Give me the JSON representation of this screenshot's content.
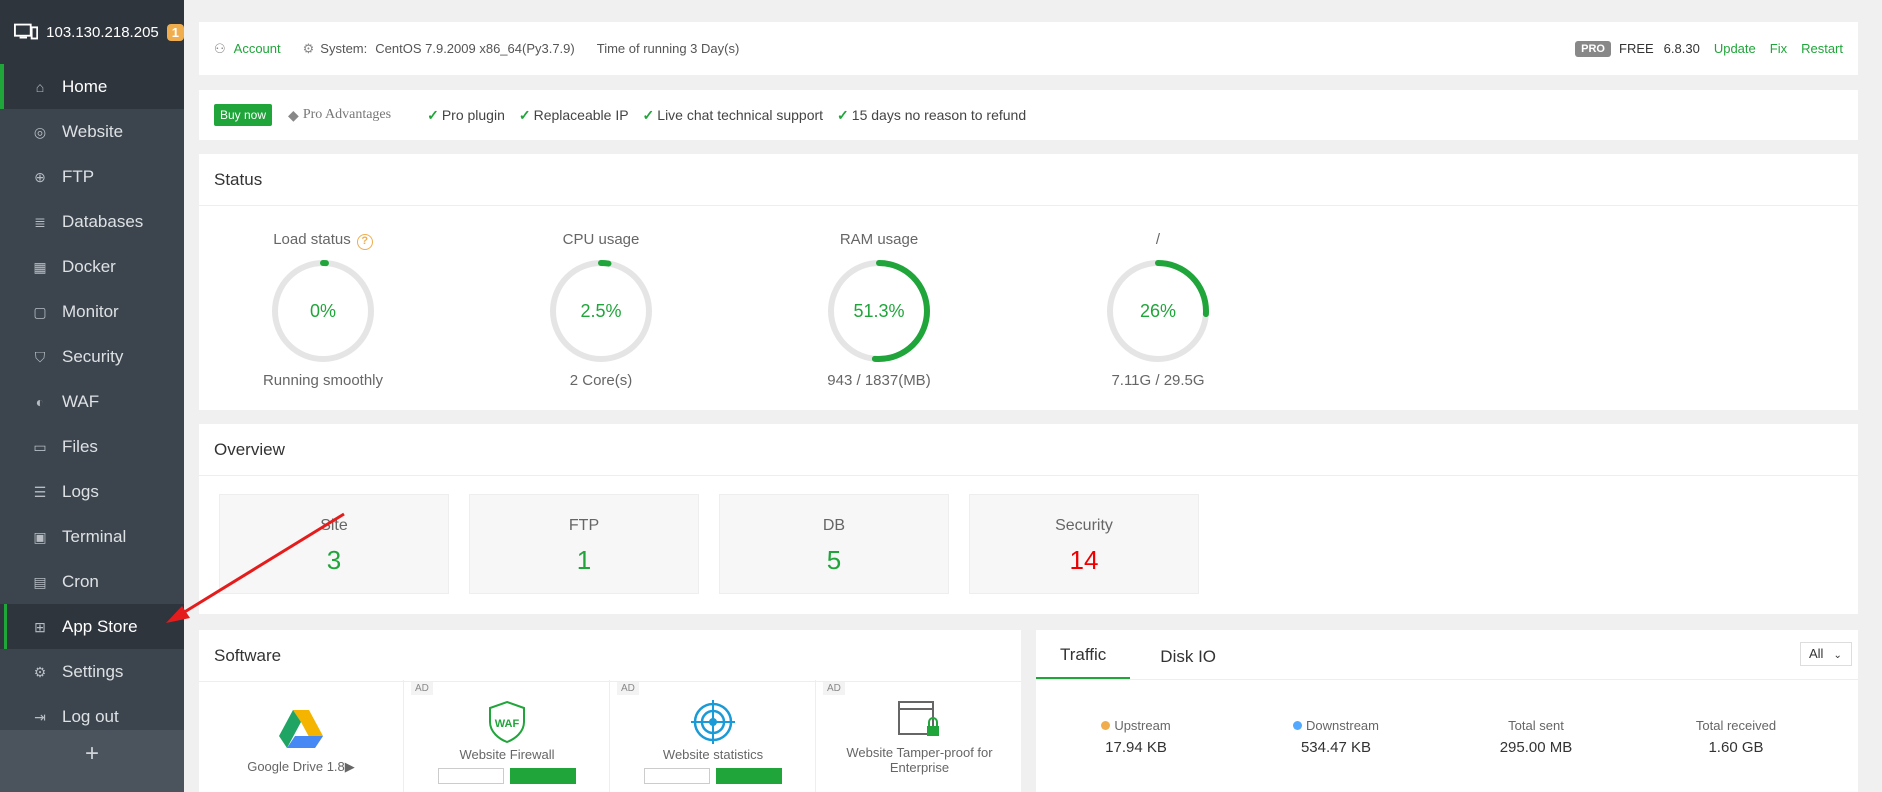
{
  "sidebar": {
    "host": "103.130.218.205",
    "badge": "1",
    "items": [
      {
        "label": "Home",
        "icon": "home-icon"
      },
      {
        "label": "Website",
        "icon": "globe-icon"
      },
      {
        "label": "FTP",
        "icon": "ftp-icon"
      },
      {
        "label": "Databases",
        "icon": "database-icon"
      },
      {
        "label": "Docker",
        "icon": "docker-icon"
      },
      {
        "label": "Monitor",
        "icon": "monitor-icon"
      },
      {
        "label": "Security",
        "icon": "shield-icon"
      },
      {
        "label": "WAF",
        "icon": "waf-shield-icon"
      },
      {
        "label": "Files",
        "icon": "folder-icon"
      },
      {
        "label": "Logs",
        "icon": "logs-icon"
      },
      {
        "label": "Terminal",
        "icon": "terminal-icon"
      },
      {
        "label": "Cron",
        "icon": "cron-icon"
      },
      {
        "label": "App Store",
        "icon": "grid-icon"
      },
      {
        "label": "Settings",
        "icon": "gear-icon"
      },
      {
        "label": "Log out",
        "icon": "logout-icon"
      }
    ],
    "add_label": "+"
  },
  "topbar": {
    "account": "Account",
    "system_label": "System:",
    "system_value": "CentOS 7.9.2009 x86_64(Py3.7.9)",
    "running": "Time of running 3 Day(s)",
    "pro": "PRO",
    "free": "FREE",
    "version": "6.8.30",
    "update": "Update",
    "fix": "Fix",
    "restart": "Restart"
  },
  "buybar": {
    "buy_now": "Buy now",
    "pro_advantages": "Pro Advantages",
    "features": [
      "Pro plugin",
      "Replaceable IP",
      "Live chat technical support",
      "15 days no reason to refund"
    ]
  },
  "status": {
    "title": "Status",
    "gauges": [
      {
        "label": "Load status",
        "value": "0%",
        "percent": 0,
        "sub": "Running smoothly",
        "help": "?"
      },
      {
        "label": "CPU usage",
        "value": "2.5%",
        "percent": 2.5,
        "sub": "2 Core(s)"
      },
      {
        "label": "RAM usage",
        "value": "51.3%",
        "percent": 51.3,
        "sub": "943 / 1837(MB)"
      },
      {
        "label": "/",
        "value": "26%",
        "percent": 26,
        "sub": "7.11G / 29.5G"
      }
    ],
    "colors": {
      "accent": "#20a53a",
      "track": "#e5e5e5"
    }
  },
  "overview": {
    "title": "Overview",
    "cards": [
      {
        "label": "Site",
        "value": "3"
      },
      {
        "label": "FTP",
        "value": "1"
      },
      {
        "label": "DB",
        "value": "5"
      },
      {
        "label": "Security",
        "value": "14"
      }
    ]
  },
  "software": {
    "title": "Software",
    "ad_label": "AD",
    "items": [
      {
        "name": "Google Drive 1.8▶",
        "icon": "google-drive-icon"
      },
      {
        "name": "Website Firewall",
        "icon": "waf-icon",
        "icon_text": "WAF"
      },
      {
        "name": "Website statistics",
        "icon": "target-icon"
      },
      {
        "name": "Website Tamper-proof for Enterprise",
        "icon": "lock-window-icon"
      }
    ]
  },
  "traffic": {
    "tabs": [
      "Traffic",
      "Disk IO"
    ],
    "select": "All",
    "stats": [
      {
        "label": "Upstream",
        "value": "17.94 KB",
        "dot": "#f0ad4e"
      },
      {
        "label": "Downstream",
        "value": "534.47 KB",
        "dot": "#52a9ff"
      },
      {
        "label": "Total sent",
        "value": "295.00 MB"
      },
      {
        "label": "Total received",
        "value": "1.60 GB"
      }
    ]
  }
}
